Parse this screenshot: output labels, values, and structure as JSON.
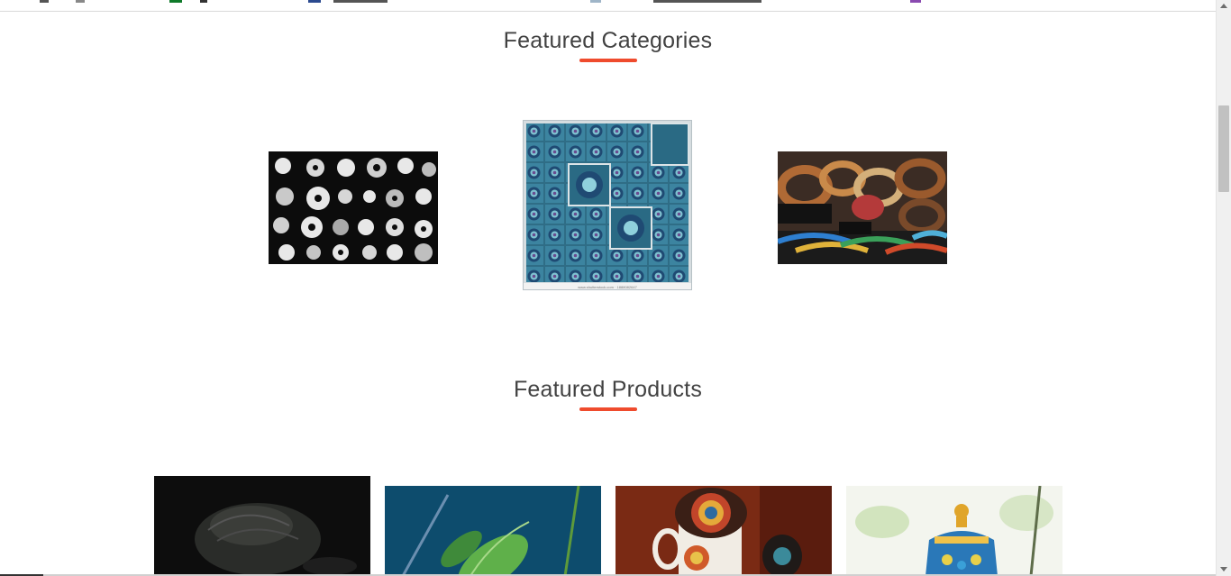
{
  "sections": {
    "categories": {
      "title": "Featured Categories",
      "items": [
        {
          "name": "black-and-white-pieces-image"
        },
        {
          "name": "blue-mosaic-tiles-image",
          "caption": "www.shutterstock.com · 1888082647"
        },
        {
          "name": "bangles-bracelets-image"
        }
      ]
    },
    "products": {
      "title": "Featured Products",
      "items": [
        {
          "name": "dark-carved-product"
        },
        {
          "name": "green-plant-product"
        },
        {
          "name": "painted-cup-product"
        },
        {
          "name": "blue-pottery-jar-product"
        }
      ]
    }
  },
  "colors": {
    "accent": "#ef4b2d",
    "title_text": "#424242",
    "background": "#ffffff"
  }
}
